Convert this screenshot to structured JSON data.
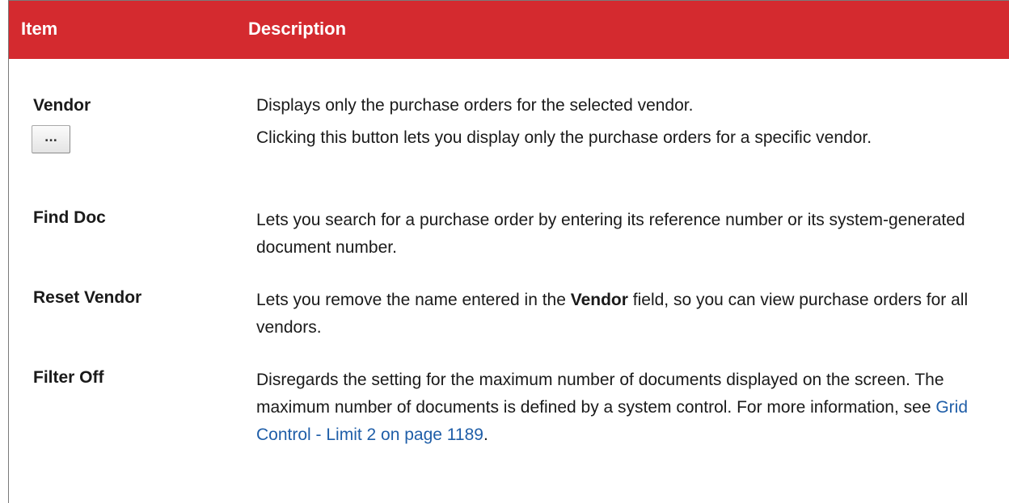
{
  "table": {
    "headers": {
      "item": "Item",
      "description": "Description"
    },
    "rows": [
      {
        "item": "Vendor",
        "description": "Displays only the purchase orders for the selected vendor."
      },
      {
        "item_button_label": "...",
        "description": "Clicking this button lets you display only the purchase orders for a specific vendor."
      },
      {
        "item": "Find Doc",
        "description": "Lets you search for a purchase order by entering its reference number or its system-generated document number."
      },
      {
        "item": "Reset Vendor",
        "description_before": "Lets you remove the name entered in the ",
        "description_bold": "Vendor",
        "description_after": " field, so you can view purchase orders for all vendors."
      },
      {
        "item": "Filter Off",
        "description_before": "Disregards the setting for the maximum number of documents displayed on the screen. The maximum number of documents is defined by a system control. For more information, see ",
        "description_link": "Grid Control - Limit 2 on page 1189",
        "description_after": "."
      }
    ]
  },
  "colors": {
    "header_background": "#d42a2f",
    "header_text": "#ffffff",
    "link": "#1f5ea8"
  }
}
